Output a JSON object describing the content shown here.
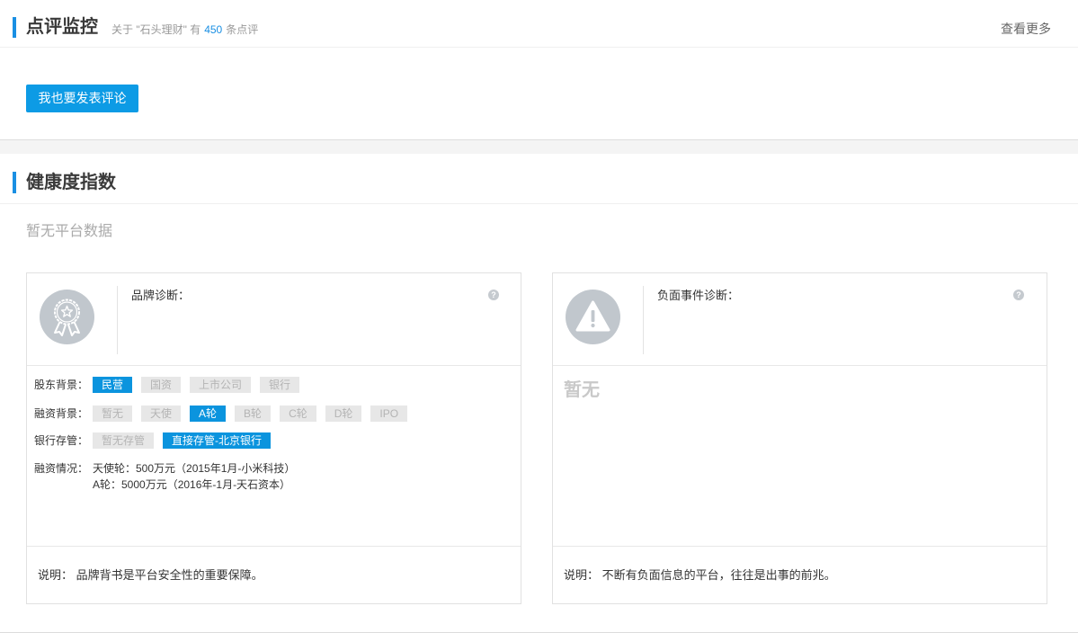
{
  "review": {
    "title": "点评监控",
    "subtitle_before": "关于 \"石头理财\" 有",
    "count": "450",
    "subtitle_after": "条点评",
    "more_link": "查看更多",
    "post_button": "我也要发表评论"
  },
  "health": {
    "title": "健康度指数",
    "no_data": "暂无平台数据",
    "brand_card": {
      "icon": "award-ribbon-icon",
      "help_icon": "help-icon",
      "title": "品牌诊断：",
      "shareholder": {
        "label": "股东背景：",
        "tags": [
          {
            "text": "民营",
            "active": true
          },
          {
            "text": "国资",
            "active": false
          },
          {
            "text": "上市公司",
            "active": false
          },
          {
            "text": "银行",
            "active": false
          }
        ]
      },
      "financing_stage": {
        "label": "融资背景：",
        "tags": [
          {
            "text": "暂无",
            "active": false
          },
          {
            "text": "天使",
            "active": false
          },
          {
            "text": "A轮",
            "active": true
          },
          {
            "text": "B轮",
            "active": false
          },
          {
            "text": "C轮",
            "active": false
          },
          {
            "text": "D轮",
            "active": false
          },
          {
            "text": "IPO",
            "active": false
          }
        ]
      },
      "bank_custody": {
        "label": "银行存管：",
        "tags": [
          {
            "text": "暂无存管",
            "active": false
          },
          {
            "text": "直接存管-北京银行",
            "active": true
          }
        ]
      },
      "financing_details": {
        "label": "融资情况：",
        "lines": [
          "天使轮：500万元（2015年1月-小米科技）",
          "A轮：5000万元（2016年-1月-天石资本）"
        ]
      },
      "note": "说明： 品牌背书是平台安全性的重要保障。"
    },
    "negative_card": {
      "icon": "warning-icon",
      "help_icon": "help-icon",
      "title": "负面事件诊断：",
      "empty_text": "暂无",
      "note": "说明： 不断有负面信息的平台，往往是出事的前兆。"
    }
  },
  "colors": {
    "accent": "#1a8fe3",
    "button": "#0d9be5",
    "tag_active": "#0b94de",
    "tag_inactive_bg": "#e7e7e7",
    "icon_circle": "#c1c7cd"
  }
}
